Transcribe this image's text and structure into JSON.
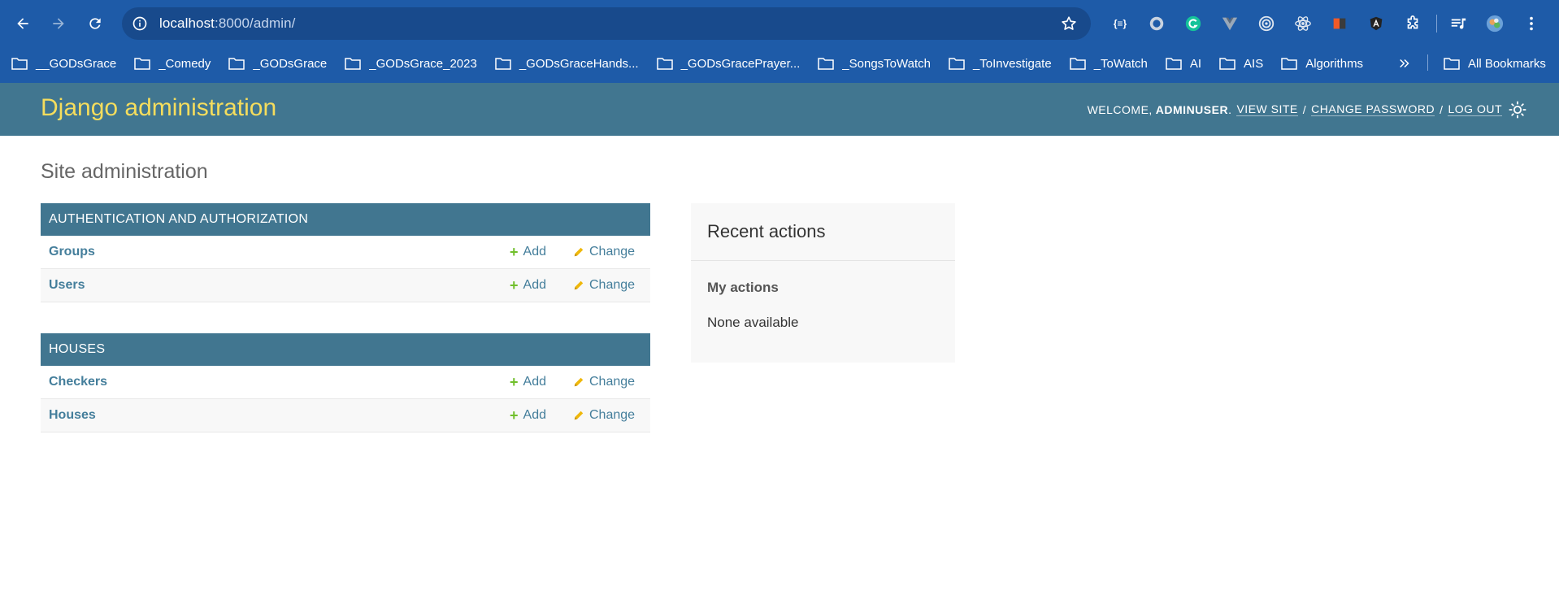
{
  "browser": {
    "url_host": "localhost",
    "url_path": ":8000/admin/",
    "bookmarks": [
      "__GODsGrace",
      "_Comedy",
      "_GODsGrace",
      "_GODsGrace_2023",
      "_GODsGraceHands...",
      "_GODsGracePrayer...",
      "_SongsToWatch",
      "_ToInvestigate",
      "_ToWatch",
      "AI",
      "AIS",
      "Algorithms"
    ],
    "all_bookmarks": "All Bookmarks",
    "ext_json_label": "{≡}"
  },
  "header": {
    "branding": "Django administration",
    "welcome": "WELCOME,",
    "username": "ADMINUSER",
    "period": ".",
    "view_site": "VIEW SITE",
    "change_password": "CHANGE PASSWORD",
    "log_out": "LOG OUT",
    "slash": "/"
  },
  "page_title": "Site administration",
  "modules": [
    {
      "caption": "AUTHENTICATION AND AUTHORIZATION",
      "rows": [
        {
          "name": "Groups",
          "add": "Add",
          "change": "Change"
        },
        {
          "name": "Users",
          "add": "Add",
          "change": "Change"
        }
      ]
    },
    {
      "caption": "HOUSES",
      "rows": [
        {
          "name": "Checkers",
          "add": "Add",
          "change": "Change"
        },
        {
          "name": "Houses",
          "add": "Add",
          "change": "Change"
        }
      ]
    }
  ],
  "recent_actions": {
    "title": "Recent actions",
    "subtitle": "My actions",
    "empty": "None available"
  },
  "colors": {
    "browser_chrome": "#1e5ba8",
    "header_bg": "#417690",
    "branding": "#f5dd5d",
    "link": "#447e9b",
    "add_icon": "#70bf2b",
    "change_icon": "#efb80b"
  }
}
